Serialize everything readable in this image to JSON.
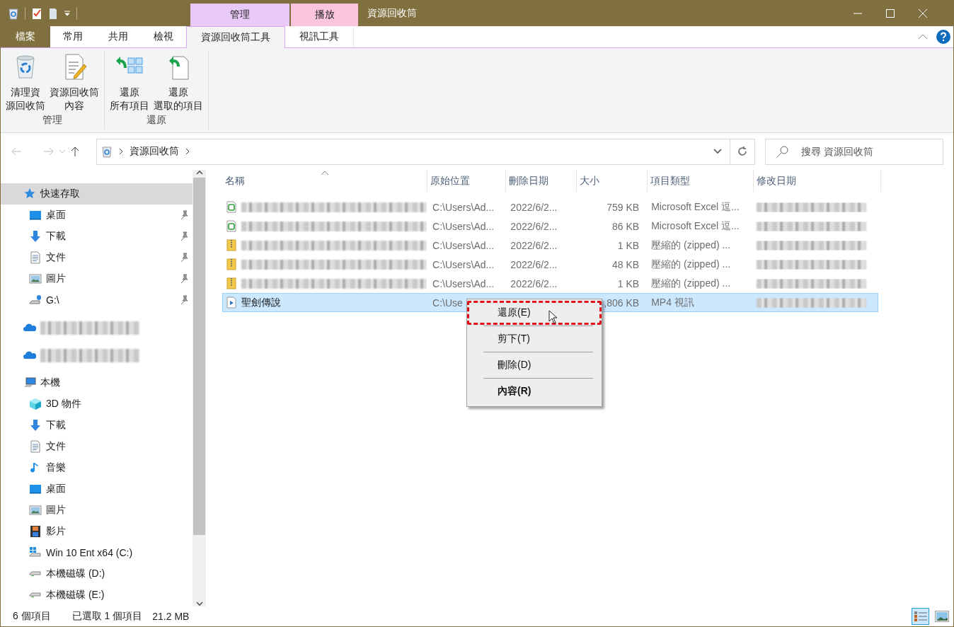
{
  "window": {
    "title": "資源回收筒"
  },
  "context_tabs": [
    {
      "label": "管理",
      "color": "#e9c9f7"
    },
    {
      "label": "播放",
      "color": "#fbc6dd"
    }
  ],
  "ribbon_tabs": [
    {
      "label": "檔案",
      "kind": "file",
      "selected": false
    },
    {
      "label": "常用",
      "kind": "tab",
      "selected": false
    },
    {
      "label": "共用",
      "kind": "tab",
      "selected": false
    },
    {
      "label": "檢視",
      "kind": "tab",
      "selected": false
    },
    {
      "label": "資源回收筒工具",
      "kind": "context",
      "selected": true
    },
    {
      "label": "視訊工具",
      "kind": "context",
      "selected": false
    }
  ],
  "ribbon_groups": [
    {
      "title": "管理",
      "buttons": [
        {
          "lines": [
            "清理資",
            "源回收筒"
          ]
        },
        {
          "lines": [
            "資源回收筒",
            "內容"
          ]
        }
      ]
    },
    {
      "title": "還原",
      "buttons": [
        {
          "lines": [
            "還原",
            "所有項目"
          ]
        },
        {
          "lines": [
            "還原",
            "選取的項目"
          ]
        }
      ]
    }
  ],
  "address": {
    "crumbs": [
      "資源回收筒"
    ]
  },
  "search": {
    "placeholder": "搜尋 資源回收筒"
  },
  "sidebar": {
    "items": [
      {
        "kind": "quickaccess",
        "label": "快速存取",
        "selected": true,
        "children": [
          {
            "kind": "desktop",
            "label": "桌面",
            "pinned": true,
            "selected": false
          },
          {
            "kind": "downloads",
            "label": "下載",
            "pinned": true,
            "selected": false
          },
          {
            "kind": "documents",
            "label": "文件",
            "pinned": true,
            "selected": false
          },
          {
            "kind": "pictures",
            "label": "圖片",
            "pinned": true,
            "selected": false
          },
          {
            "kind": "netdrive",
            "label": "G:\\",
            "pinned": true,
            "selected": false
          }
        ]
      },
      {
        "kind": "cloud",
        "label_blurred": true,
        "selected": false
      },
      {
        "kind": "cloud",
        "label_blurred": true,
        "selected": false
      },
      {
        "kind": "computer",
        "label": "本機",
        "selected": false,
        "children": [
          {
            "kind": "objects",
            "label": "3D 物件",
            "pinned": false,
            "selected": false
          },
          {
            "kind": "downloads",
            "label": "下載",
            "pinned": false,
            "selected": false
          },
          {
            "kind": "documents",
            "label": "文件",
            "pinned": false,
            "selected": false
          },
          {
            "kind": "music",
            "label": "音樂",
            "pinned": false,
            "selected": false
          },
          {
            "kind": "desktop",
            "label": "桌面",
            "pinned": false,
            "selected": false
          },
          {
            "kind": "pictures",
            "label": "圖片",
            "pinned": false,
            "selected": false
          },
          {
            "kind": "videos",
            "label": "影片",
            "pinned": false,
            "selected": false
          },
          {
            "kind": "sysdrive",
            "label": "Win 10 Ent x64 (C:)",
            "pinned": false,
            "selected": false
          },
          {
            "kind": "drive",
            "label": "本機磁碟 (D:)",
            "pinned": false,
            "selected": false
          },
          {
            "kind": "drive",
            "label": "本機磁碟 (E:)",
            "pinned": false,
            "selected": false
          }
        ]
      }
    ]
  },
  "table": {
    "columns": [
      {
        "label": "名稱",
        "sorted": true
      },
      {
        "label": "原始位置",
        "sorted": false
      },
      {
        "label": "刪除日期",
        "sorted": false
      },
      {
        "label": "大小",
        "sorted": false
      },
      {
        "label": "項目類型",
        "sorted": false
      },
      {
        "label": "修改日期",
        "sorted": false
      }
    ],
    "rows": [
      {
        "kind": "spreadsheet",
        "name_blurred": true,
        "location": "C:\\Users\\Ad...",
        "deleted": "2022/6/2...",
        "size": "759 KB",
        "type": "Microsoft Excel 逗...",
        "modified_blurred": true,
        "selected": false
      },
      {
        "kind": "spreadsheet",
        "name_blurred": true,
        "location": "C:\\Users\\Ad...",
        "deleted": "2022/6/2...",
        "size": "86 KB",
        "type": "Microsoft Excel 逗...",
        "modified_blurred": true,
        "selected": false
      },
      {
        "kind": "zip",
        "name_blurred": true,
        "location": "C:\\Users\\Ad...",
        "deleted": "2022/6/2...",
        "size": "1 KB",
        "type": "壓縮的 (zipped) ...",
        "modified_blurred": true,
        "selected": false
      },
      {
        "kind": "zip",
        "name_blurred": true,
        "location": "C:\\Users\\Ad...",
        "deleted": "2022/6/2...",
        "size": "48 KB",
        "type": "壓縮的 (zipped) ...",
        "modified_blurred": true,
        "selected": false
      },
      {
        "kind": "zip",
        "name_blurred": true,
        "location": "C:\\Users\\Ad...",
        "deleted": "2022/6/2...",
        "size": "1 KB",
        "type": "壓縮的 (zipped) ...",
        "modified_blurred": true,
        "selected": false
      },
      {
        "kind": "video",
        "name": "聖劍傳說",
        "name_blurred": false,
        "location": "C:\\Use",
        "size": ",806 KB",
        "type": "MP4 視訊",
        "modified_blurred": true,
        "selected": true
      }
    ]
  },
  "context_menu": {
    "items": [
      {
        "label": "還原(E)",
        "highlighted": true,
        "bold": false
      },
      {
        "label": "剪下(T)",
        "highlighted": false,
        "bold": false
      },
      {
        "label": "刪除(D)",
        "highlighted": false,
        "bold": false
      },
      {
        "label": "內容(R)",
        "highlighted": false,
        "bold": true
      }
    ]
  },
  "status_bar": {
    "item_count": "6 個項目",
    "selection": "已選取 1 個項目",
    "size": "21.2 MB"
  },
  "view_buttons": [
    {
      "kind": "details",
      "selected": true
    },
    {
      "kind": "largeicons",
      "selected": false
    }
  ]
}
